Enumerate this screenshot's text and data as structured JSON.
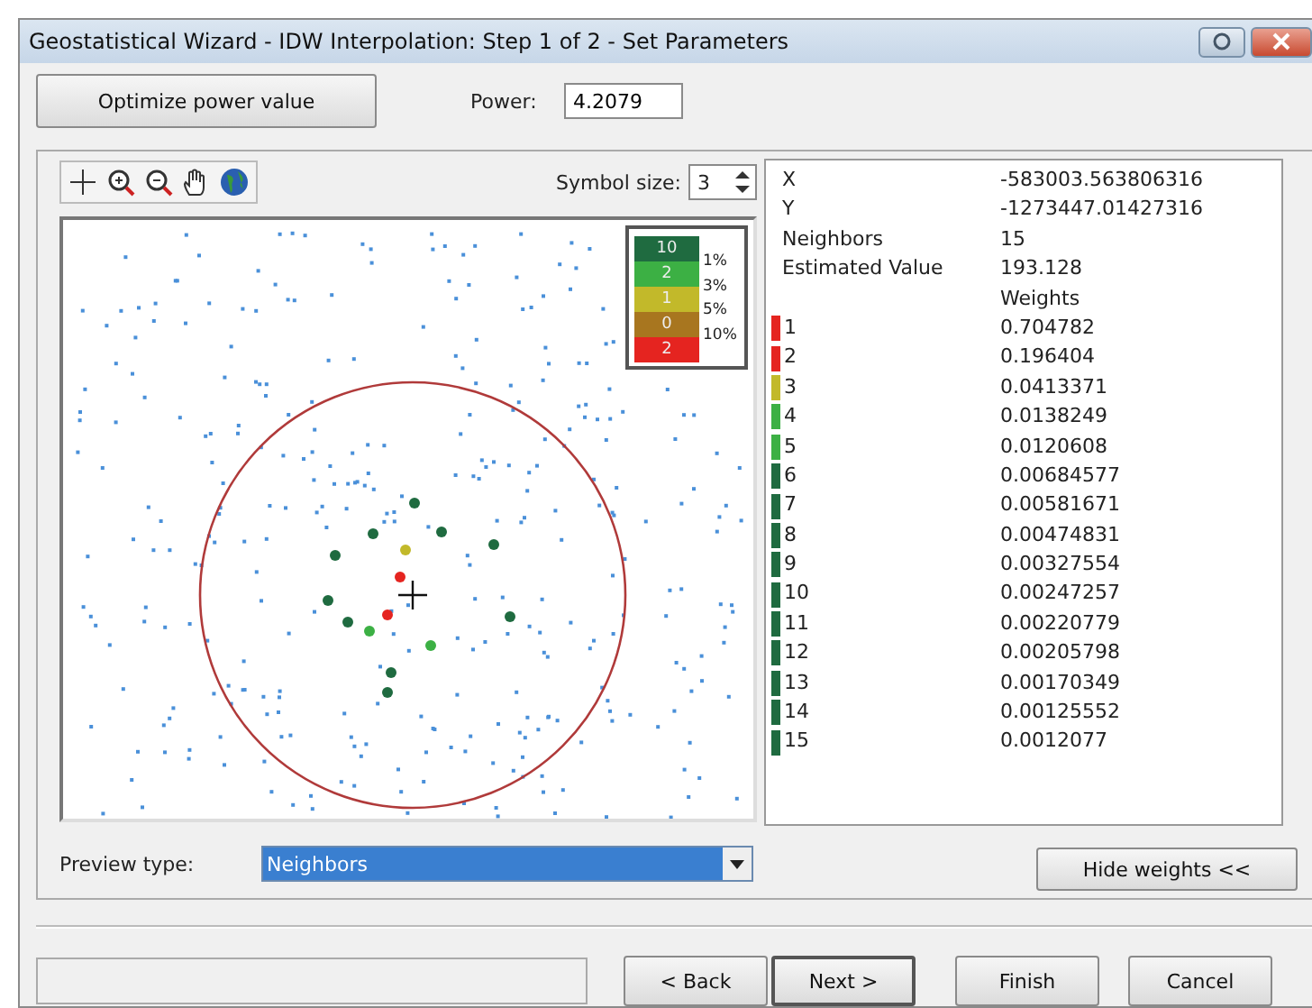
{
  "window": {
    "title": "Geostatistical Wizard - IDW Interpolation: Step 1 of 2 - Set Parameters"
  },
  "optimize_button": "Optimize power value",
  "power": {
    "label": "Power:",
    "value": "4.2079"
  },
  "symbol_size": {
    "label": "Symbol size:",
    "value": "3"
  },
  "legend": {
    "items": [
      {
        "count": "10",
        "color": "#1f6b40"
      },
      {
        "count": "2",
        "color": "#3cb044"
      },
      {
        "count": "1",
        "color": "#c2b92a"
      },
      {
        "count": "0",
        "color": "#a8761f"
      },
      {
        "count": "2",
        "color": "#e52420"
      }
    ],
    "percents": [
      "1%",
      "3%",
      "5%",
      "10%"
    ]
  },
  "info": [
    {
      "label": "X",
      "value": "-583003.563806316"
    },
    {
      "label": "Y",
      "value": "-1273447.01427316"
    },
    {
      "label": "Neighbors",
      "value": "15"
    },
    {
      "label": "Estimated Value",
      "value": "193.128"
    }
  ],
  "weights_header": "Weights",
  "weights": [
    {
      "index": "1",
      "value": "0.704782",
      "color": "#e52420"
    },
    {
      "index": "2",
      "value": "0.196404",
      "color": "#e52420"
    },
    {
      "index": "3",
      "value": "0.0413371",
      "color": "#c2b92a"
    },
    {
      "index": "4",
      "value": "0.0138249",
      "color": "#3cb044"
    },
    {
      "index": "5",
      "value": "0.0120608",
      "color": "#3cb044"
    },
    {
      "index": "6",
      "value": "0.00684577",
      "color": "#1f6b40"
    },
    {
      "index": "7",
      "value": "0.00581671",
      "color": "#1f6b40"
    },
    {
      "index": "8",
      "value": "0.00474831",
      "color": "#1f6b40"
    },
    {
      "index": "9",
      "value": "0.00327554",
      "color": "#1f6b40"
    },
    {
      "index": "10",
      "value": "0.00247257",
      "color": "#1f6b40"
    },
    {
      "index": "11",
      "value": "0.00220779",
      "color": "#1f6b40"
    },
    {
      "index": "12",
      "value": "0.00205798",
      "color": "#1f6b40"
    },
    {
      "index": "13",
      "value": "0.00170349",
      "color": "#1f6b40"
    },
    {
      "index": "14",
      "value": "0.00125552",
      "color": "#1f6b40"
    },
    {
      "index": "15",
      "value": "0.0012077",
      "color": "#1f6b40"
    }
  ],
  "preview_type": {
    "label": "Preview type:",
    "value": "Neighbors"
  },
  "hide_weights_button": "Hide weights <<",
  "nav_buttons": [
    {
      "label": "< Back",
      "default": false
    },
    {
      "label": "Next >",
      "default": true
    },
    {
      "label": "Finish",
      "default": false
    },
    {
      "label": "Cancel",
      "default": false
    }
  ]
}
